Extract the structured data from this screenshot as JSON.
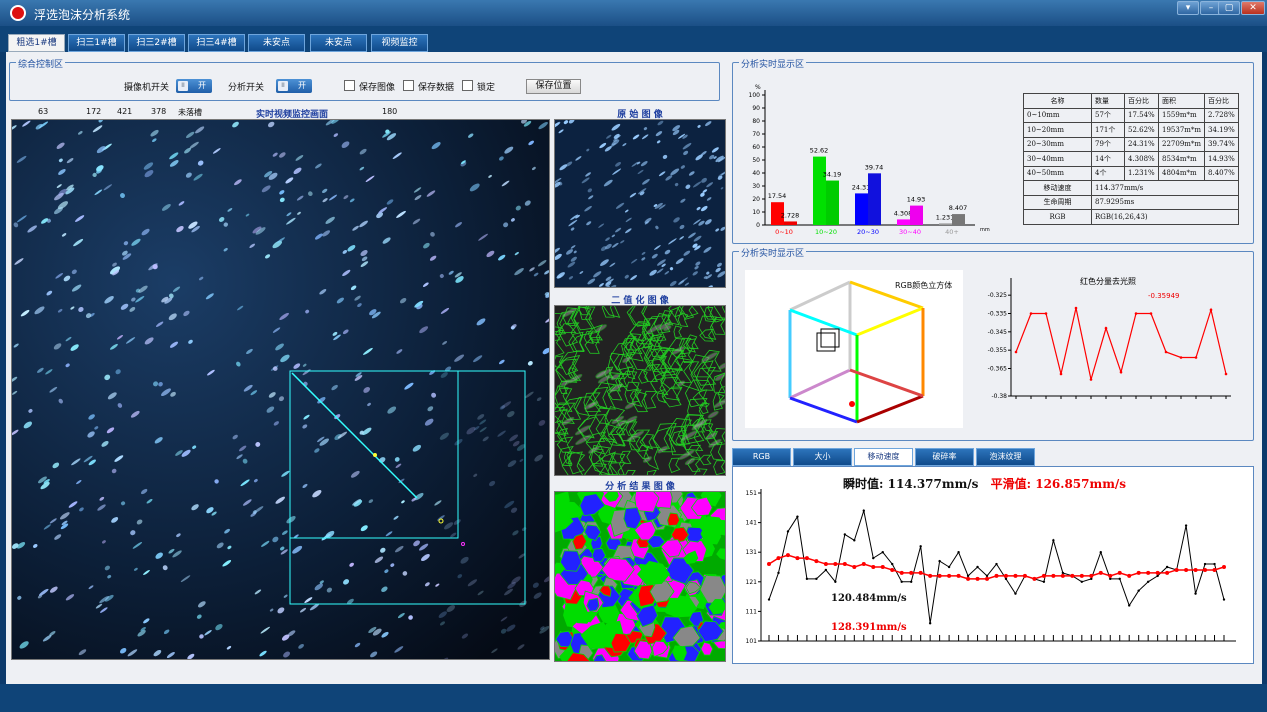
{
  "window": {
    "title": "浮选泡沫分析系统",
    "ctl_labels": [
      "▾",
      "–",
      "▢",
      "✕"
    ]
  },
  "tabs": [
    "粗选1#槽",
    "扫三1#槽",
    "扫三2#槽",
    "扫三4#槽",
    "未安点",
    "未安点",
    "视频监控"
  ],
  "control": {
    "group_title": "综合控制区",
    "camera_label": "摄像机开关",
    "camera_state": "开",
    "analysis_label": "分析开关",
    "analysis_state": "开",
    "knob": "II",
    "save_image": "保存图像",
    "save_data": "保存数据",
    "lock": "锁定",
    "save_pos": "保存位置"
  },
  "video": {
    "nums": [
      "63",
      "172",
      "421",
      "378"
    ],
    "slot_label": "未落槽",
    "title": "实时视频监控画面",
    "num_right": "180"
  },
  "panels": {
    "orig": "原 始 图 像",
    "binary": "二 值 化 图 像",
    "result": "分 析 结 果 图 像"
  },
  "analysis_top": {
    "title": "分析实时显示区"
  },
  "analysis_mid": {
    "title": "分析实时显示区",
    "cube_title": "RGB颜色立方体",
    "red_title": "红色分量去光照",
    "red_value": "-0.35949"
  },
  "table": {
    "headers": [
      "名称",
      "数量",
      "百分比",
      "面积",
      "百分比"
    ],
    "rows": [
      [
        "0~10mm",
        "57个",
        "17.54%",
        "1559m*m",
        "2.728%"
      ],
      [
        "10~20mm",
        "171个",
        "52.62%",
        "19537m*m",
        "34.19%"
      ],
      [
        "20~30mm",
        "79个",
        "24.31%",
        "22709m*m",
        "39.74%"
      ],
      [
        "30~40mm",
        "14个",
        "4.308%",
        "8534m*m",
        "14.93%"
      ],
      [
        "40~50mm",
        "4个",
        "1.231%",
        "4804m*m",
        "8.407%"
      ]
    ],
    "speed_label": "移动速度",
    "speed_value": "114.377mm/s",
    "life_label": "生命周期",
    "life_value": "87.9295ms",
    "rgb_label": "RGB",
    "rgb_value": "RGB(16,26,43)"
  },
  "bottom_tabs": [
    "RGB",
    "大小",
    "移动速度",
    "破碎率",
    "泡沫纹理"
  ],
  "speed": {
    "instant_label": "瞬时值: ",
    "instant_value": "114.377mm/s",
    "smooth_label": "平滑值: ",
    "smooth_value": "126.857mm/s",
    "annot_black": "120.484mm/s",
    "annot_red": "128.391mm/s"
  },
  "chart_data": [
    {
      "type": "bar",
      "categories": [
        "0~10",
        "10~20",
        "20~30",
        "30~40",
        "40+"
      ],
      "series": [
        {
          "values": [
            17.54,
            52.62,
            24.31,
            4.308,
            1.231
          ]
        },
        {
          "values": [
            2.728,
            34.19,
            39.74,
            14.93,
            8.407
          ]
        }
      ],
      "data_labels": [
        [
          "17.54",
          "52.62",
          "24.31",
          "4.308",
          "1.231"
        ],
        [
          "2.728",
          "34.19",
          "39.74",
          "14.93",
          "8.407"
        ]
      ],
      "colors": [
        "#ff0000",
        "#00e000",
        "#0000ff",
        "#ff00ff",
        "#999999"
      ],
      "ylabel": "%",
      "xunit": "mm",
      "ylim": [
        0,
        100
      ],
      "yticks": [
        "0",
        "10",
        "20",
        "30",
        "40",
        "50",
        "60",
        "70",
        "80",
        "90",
        "100"
      ]
    },
    {
      "type": "line",
      "title": "红色分量去光照",
      "ylim": [
        -0.38,
        -0.32
      ],
      "yticks": [
        "-0.325",
        "-0.335",
        "-0.345",
        "-0.355",
        "-0.365",
        "-0.38"
      ],
      "y": [
        -0.356,
        -0.335,
        -0.335,
        -0.368,
        -0.332,
        -0.371,
        -0.343,
        -0.367,
        -0.335,
        -0.335,
        -0.356,
        -0.359,
        -0.359,
        -0.333,
        -0.368
      ],
      "color": "#ff0000"
    },
    {
      "type": "line",
      "ylim": [
        101,
        151
      ],
      "yticks": [
        "101",
        "111",
        "121",
        "131",
        "141",
        "151"
      ],
      "series": [
        {
          "color": "#000000",
          "y": [
            115,
            124,
            138,
            143,
            122,
            122,
            125,
            121,
            137,
            135,
            145,
            129,
            131,
            127,
            121,
            121,
            133,
            107,
            128,
            126,
            131,
            123,
            126,
            123,
            127,
            122,
            117,
            123,
            122,
            121,
            135,
            124,
            123,
            121,
            122,
            131,
            122,
            122,
            113,
            118,
            121,
            123,
            126,
            125,
            140,
            117,
            127,
            127,
            115
          ]
        },
        {
          "color": "#ff0000",
          "y": [
            127,
            129,
            130,
            129,
            129,
            128,
            127,
            127,
            127,
            126,
            127,
            126,
            126,
            125,
            124,
            124,
            124,
            123,
            123,
            123,
            123,
            122,
            122,
            122,
            123,
            123,
            123,
            123,
            122,
            123,
            123,
            123,
            123,
            123,
            123,
            124,
            123,
            124,
            123,
            124,
            124,
            124,
            124,
            125,
            125,
            125,
            125,
            125,
            126
          ]
        }
      ]
    }
  ]
}
